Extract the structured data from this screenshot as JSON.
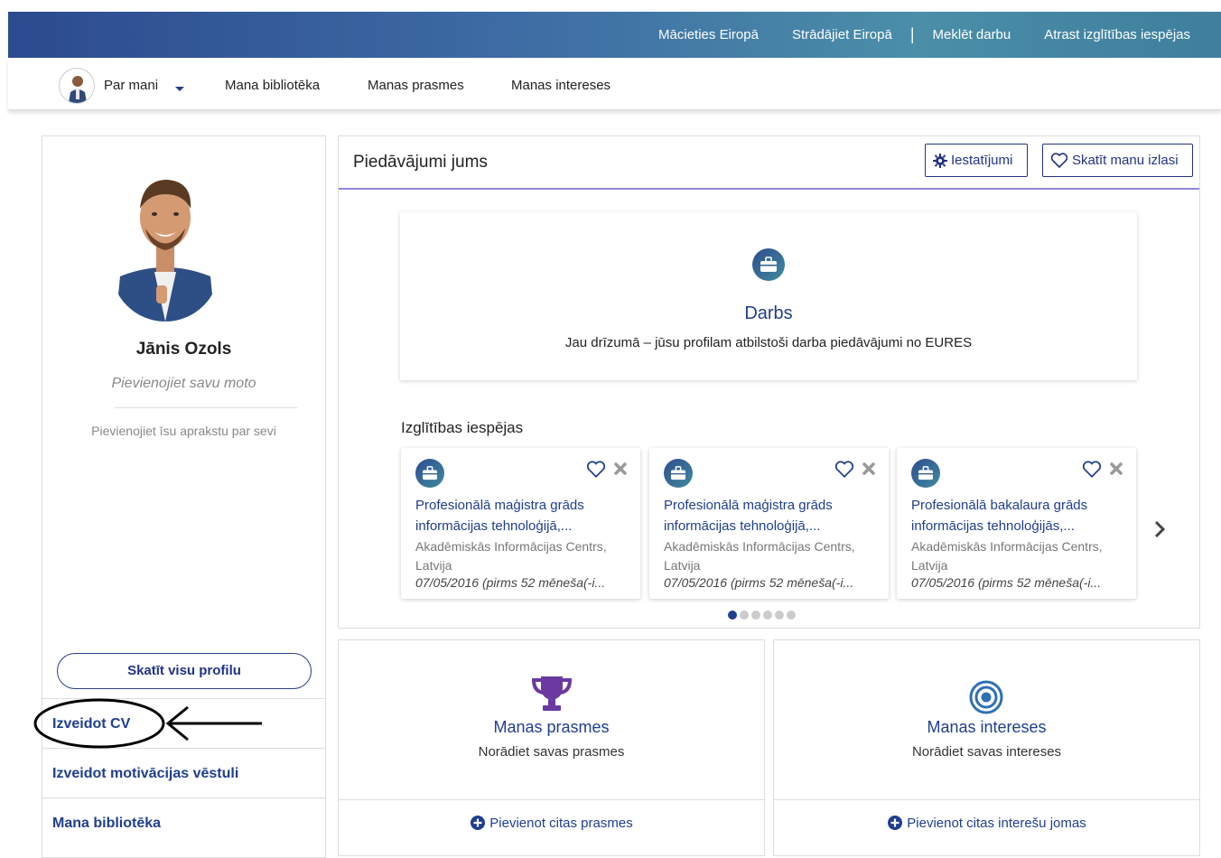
{
  "top_links": [
    "Mācieties Eiropā",
    "Strādājiet Eiropā",
    "|",
    "Meklēt darbu",
    "Atrast izglītības iespējas"
  ],
  "nav": {
    "about": "Par mani",
    "library": "Mana bibliotēka",
    "skills": "Manas prasmes",
    "interests": "Manas intereses"
  },
  "profile": {
    "name": "Jānis Ozols",
    "moto_placeholder": "Pievienojiet savu moto",
    "desc_placeholder": "Pievienojiet īsu aprakstu par sevi",
    "view_profile": "Skatīt visu profilu"
  },
  "left_links": [
    "Izveidot CV",
    "Izveidot motivācijas vēstuli",
    "Mana bibliotēka"
  ],
  "offers": {
    "title": "Piedāvājumi jums",
    "settings_btn": "Iestatījumi",
    "selection_btn": "Skatīt manu izlasi",
    "job": {
      "title": "Darbs",
      "desc": "Jau drīzumā – jūsu profilam atbilstoši darba piedāvājumi no EURES"
    },
    "education_title": "Izglītības iespējas",
    "cards": [
      {
        "title_line1": "Profesionālā maģistra grāds",
        "title_line2": "informācijas tehnoloģijā,...",
        "org_line1": "Akadēmiskās Informācijas Centrs,",
        "org_line2": "Latvija",
        "date": "07/05/2016 (pirms 52 mēneša(-i..."
      },
      {
        "title_line1": "Profesionālā maģistra grāds",
        "title_line2": "informācijas tehnoloģijā,...",
        "org_line1": "Akadēmiskās Informācijas Centrs,",
        "org_line2": "Latvija",
        "date": "07/05/2016 (pirms 52 mēneša(-i..."
      },
      {
        "title_line1": "Profesionālā bakalaura grāds",
        "title_line2": "informācijas tehnoloģijās,...",
        "org_line1": "Akadēmiskās Informācijas Centrs,",
        "org_line2": "Latvija",
        "date": "07/05/2016 (pirms 52 mēneša(-i..."
      }
    ]
  },
  "skills_card": {
    "title": "Manas prasmes",
    "desc": "Norādiet savas prasmes",
    "link": "Pievienot citas prasmes"
  },
  "interests_card": {
    "title": "Manas intereses",
    "desc": "Norādiet savas intereses",
    "link": "Pievienot citas interešu jomas"
  },
  "colors": {
    "brand": "#1f3e8f",
    "accent_purple": "#6a3aa0",
    "underline": "#8c87d8"
  }
}
